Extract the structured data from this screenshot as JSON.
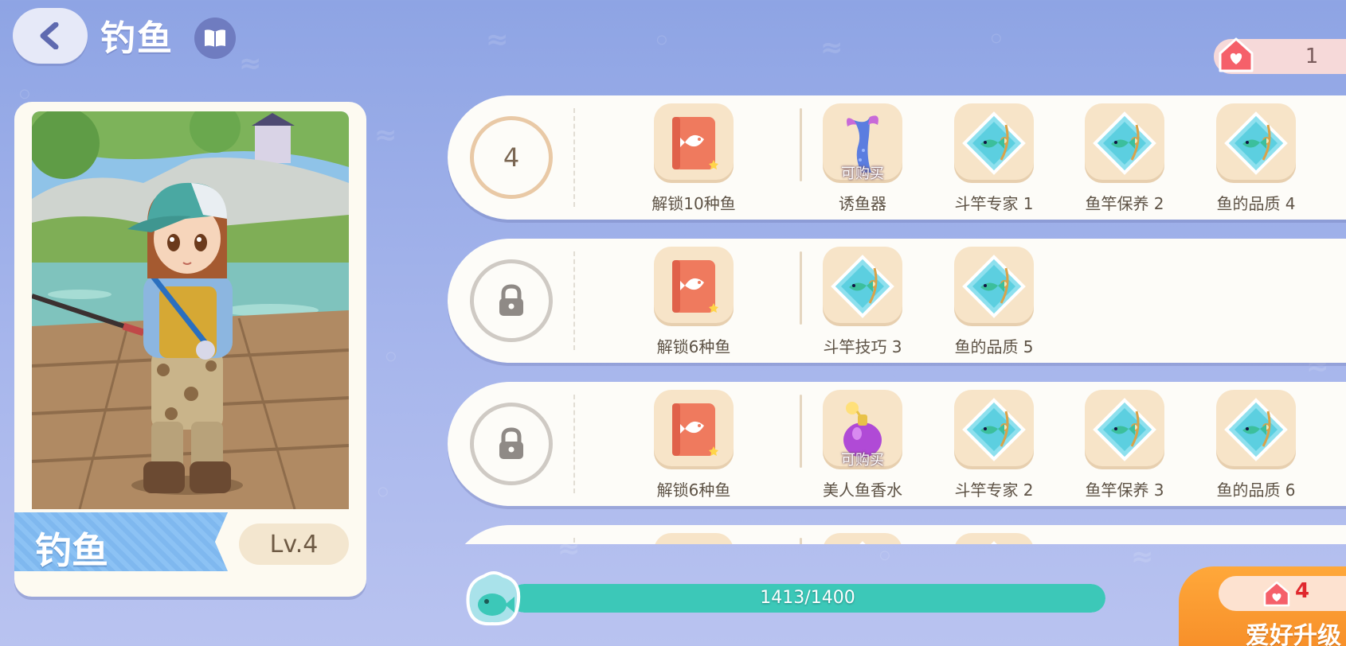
{
  "header": {
    "title": "钓鱼"
  },
  "home_counter": {
    "value": "1"
  },
  "character": {
    "hobby_name": "钓鱼",
    "level": "Lv.4"
  },
  "rows": [
    {
      "level": "4",
      "locked": false,
      "items": [
        {
          "icon": "fish-book-icon",
          "label": "解锁10种鱼",
          "buy": ""
        },
        {
          "icon": "mermaid-tail-lure-icon",
          "label": "诱鱼器",
          "buy": "可购买"
        },
        {
          "icon": "fishing-skill-icon",
          "label": "斗竿专家 1",
          "buy": ""
        },
        {
          "icon": "fishing-skill-icon",
          "label": "鱼竿保养 2",
          "buy": ""
        },
        {
          "icon": "fishing-skill-icon",
          "label": "鱼的品质 4",
          "buy": ""
        }
      ]
    },
    {
      "level": "",
      "locked": true,
      "items": [
        {
          "icon": "fish-book-icon",
          "label": "解锁6种鱼",
          "buy": ""
        },
        {
          "icon": "fishing-skill-icon",
          "label": "斗竿技巧 3",
          "buy": ""
        },
        {
          "icon": "fishing-skill-icon",
          "label": "鱼的品质 5",
          "buy": ""
        }
      ]
    },
    {
      "level": "",
      "locked": true,
      "items": [
        {
          "icon": "fish-book-icon",
          "label": "解锁6种鱼",
          "buy": ""
        },
        {
          "icon": "mermaid-perfume-icon",
          "label": "美人鱼香水",
          "buy": "可购买"
        },
        {
          "icon": "fishing-skill-icon",
          "label": "斗竿专家 2",
          "buy": ""
        },
        {
          "icon": "fishing-skill-icon",
          "label": "鱼竿保养 3",
          "buy": ""
        },
        {
          "icon": "fishing-skill-icon",
          "label": "鱼的品质 6",
          "buy": ""
        }
      ]
    },
    {
      "level": "",
      "locked": true,
      "items": [
        {
          "icon": "fish-book-icon",
          "label": "",
          "buy": ""
        },
        {
          "icon": "fishing-skill-icon",
          "label": "",
          "buy": ""
        },
        {
          "icon": "fishing-skill-icon",
          "label": "",
          "buy": ""
        }
      ]
    }
  ],
  "progress": {
    "text": "1413/1400",
    "fraction": 1.0,
    "fill_color": "#3cc8b8"
  },
  "upgrade": {
    "cost": "4",
    "label": "爱好升级"
  },
  "colors": {
    "background": "#8ea4e4",
    "card": "#fdfcf8",
    "accent_orange": "#f7902a",
    "heart_red": "#e0282d"
  }
}
